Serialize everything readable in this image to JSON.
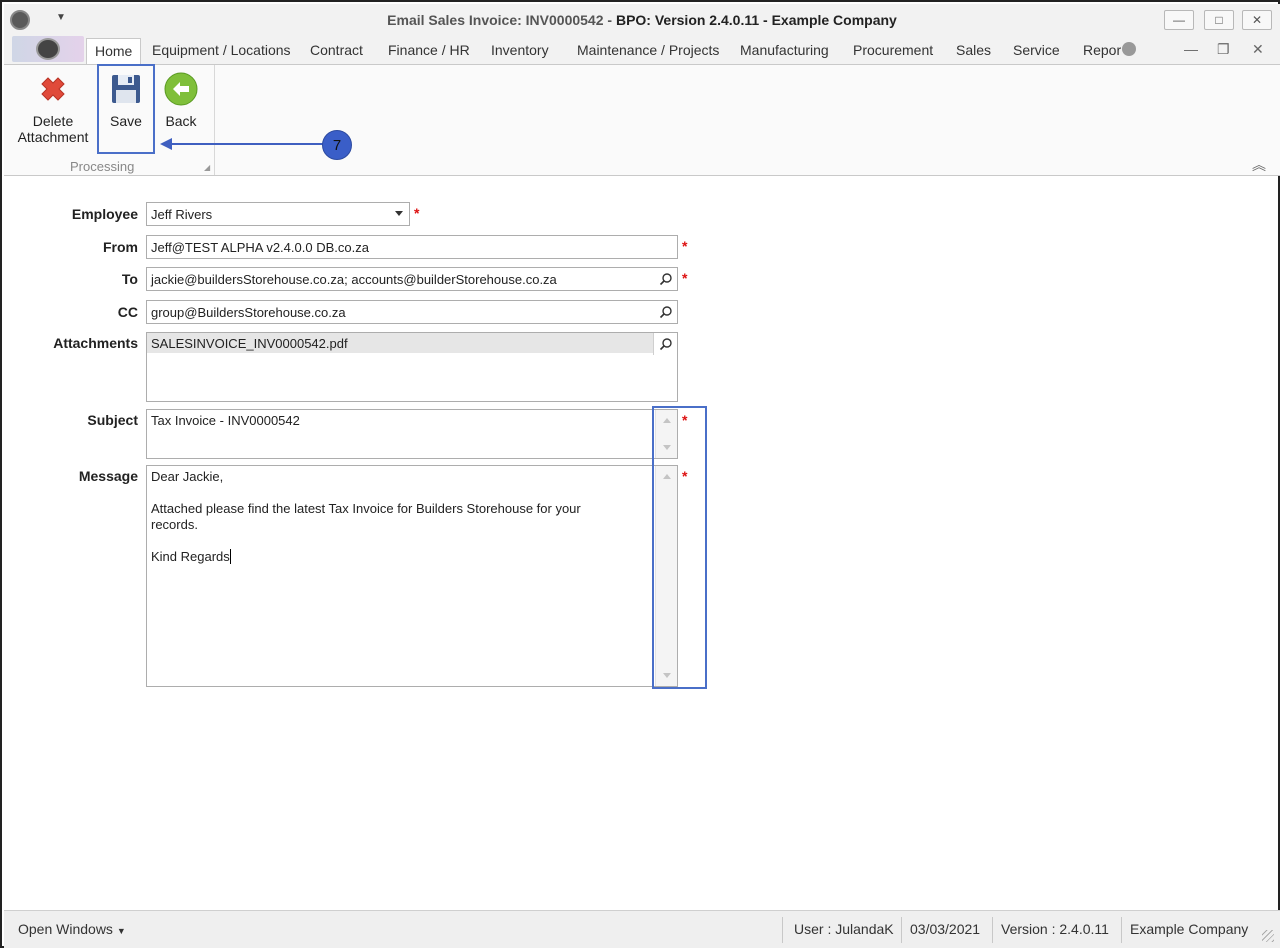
{
  "window": {
    "title_prefix": "Email Sales Invoice: INV0000542 - ",
    "title_app": "BPO: Version 2.4.0.11 - Example Company",
    "minimize": "—",
    "maximize": "□",
    "close": "✕"
  },
  "ribbon": {
    "tabs": [
      "Home",
      "Equipment / Locations",
      "Contract",
      "Finance / HR",
      "Inventory",
      "Maintenance / Projects",
      "Manufacturing",
      "Procurement",
      "Sales",
      "Service",
      "Repor"
    ],
    "mdi": {
      "minimize": "—",
      "restore": "❐",
      "close": "✕"
    },
    "buttons": {
      "delete_line1": "Delete",
      "delete_line2": "Attachment",
      "save": "Save",
      "back": "Back"
    },
    "group_label": "Processing",
    "callout_number": "7"
  },
  "form": {
    "employee": {
      "label": "Employee",
      "value": "Jeff Rivers"
    },
    "from": {
      "label": "From",
      "value": "Jeff@TEST ALPHA v2.4.0.0 DB.co.za"
    },
    "to": {
      "label": "To",
      "value": "jackie@buildersStorehouse.co.za; accounts@builderStorehouse.co.za"
    },
    "cc": {
      "label": "CC",
      "value": "group@BuildersStorehouse.co.za"
    },
    "attachments": {
      "label": "Attachments",
      "items": [
        "SALESINVOICE_INV0000542.pdf"
      ]
    },
    "subject": {
      "label": "Subject",
      "value": "Tax Invoice - INV0000542"
    },
    "message": {
      "label": "Message",
      "value": "Dear Jackie,\n\nAttached please find the latest Tax Invoice for Builders Storehouse for your\nrecords.\n\nKind Regards"
    },
    "required_mark": "*"
  },
  "statusbar": {
    "open_windows": "Open Windows",
    "user": "User : JulandaK",
    "date": "03/03/2021",
    "version": "Version : 2.4.0.11",
    "company": "Example Company"
  },
  "colors": {
    "highlight": "#4a6fc8",
    "required": "#dd1111",
    "callout": "#3a5ec8"
  }
}
